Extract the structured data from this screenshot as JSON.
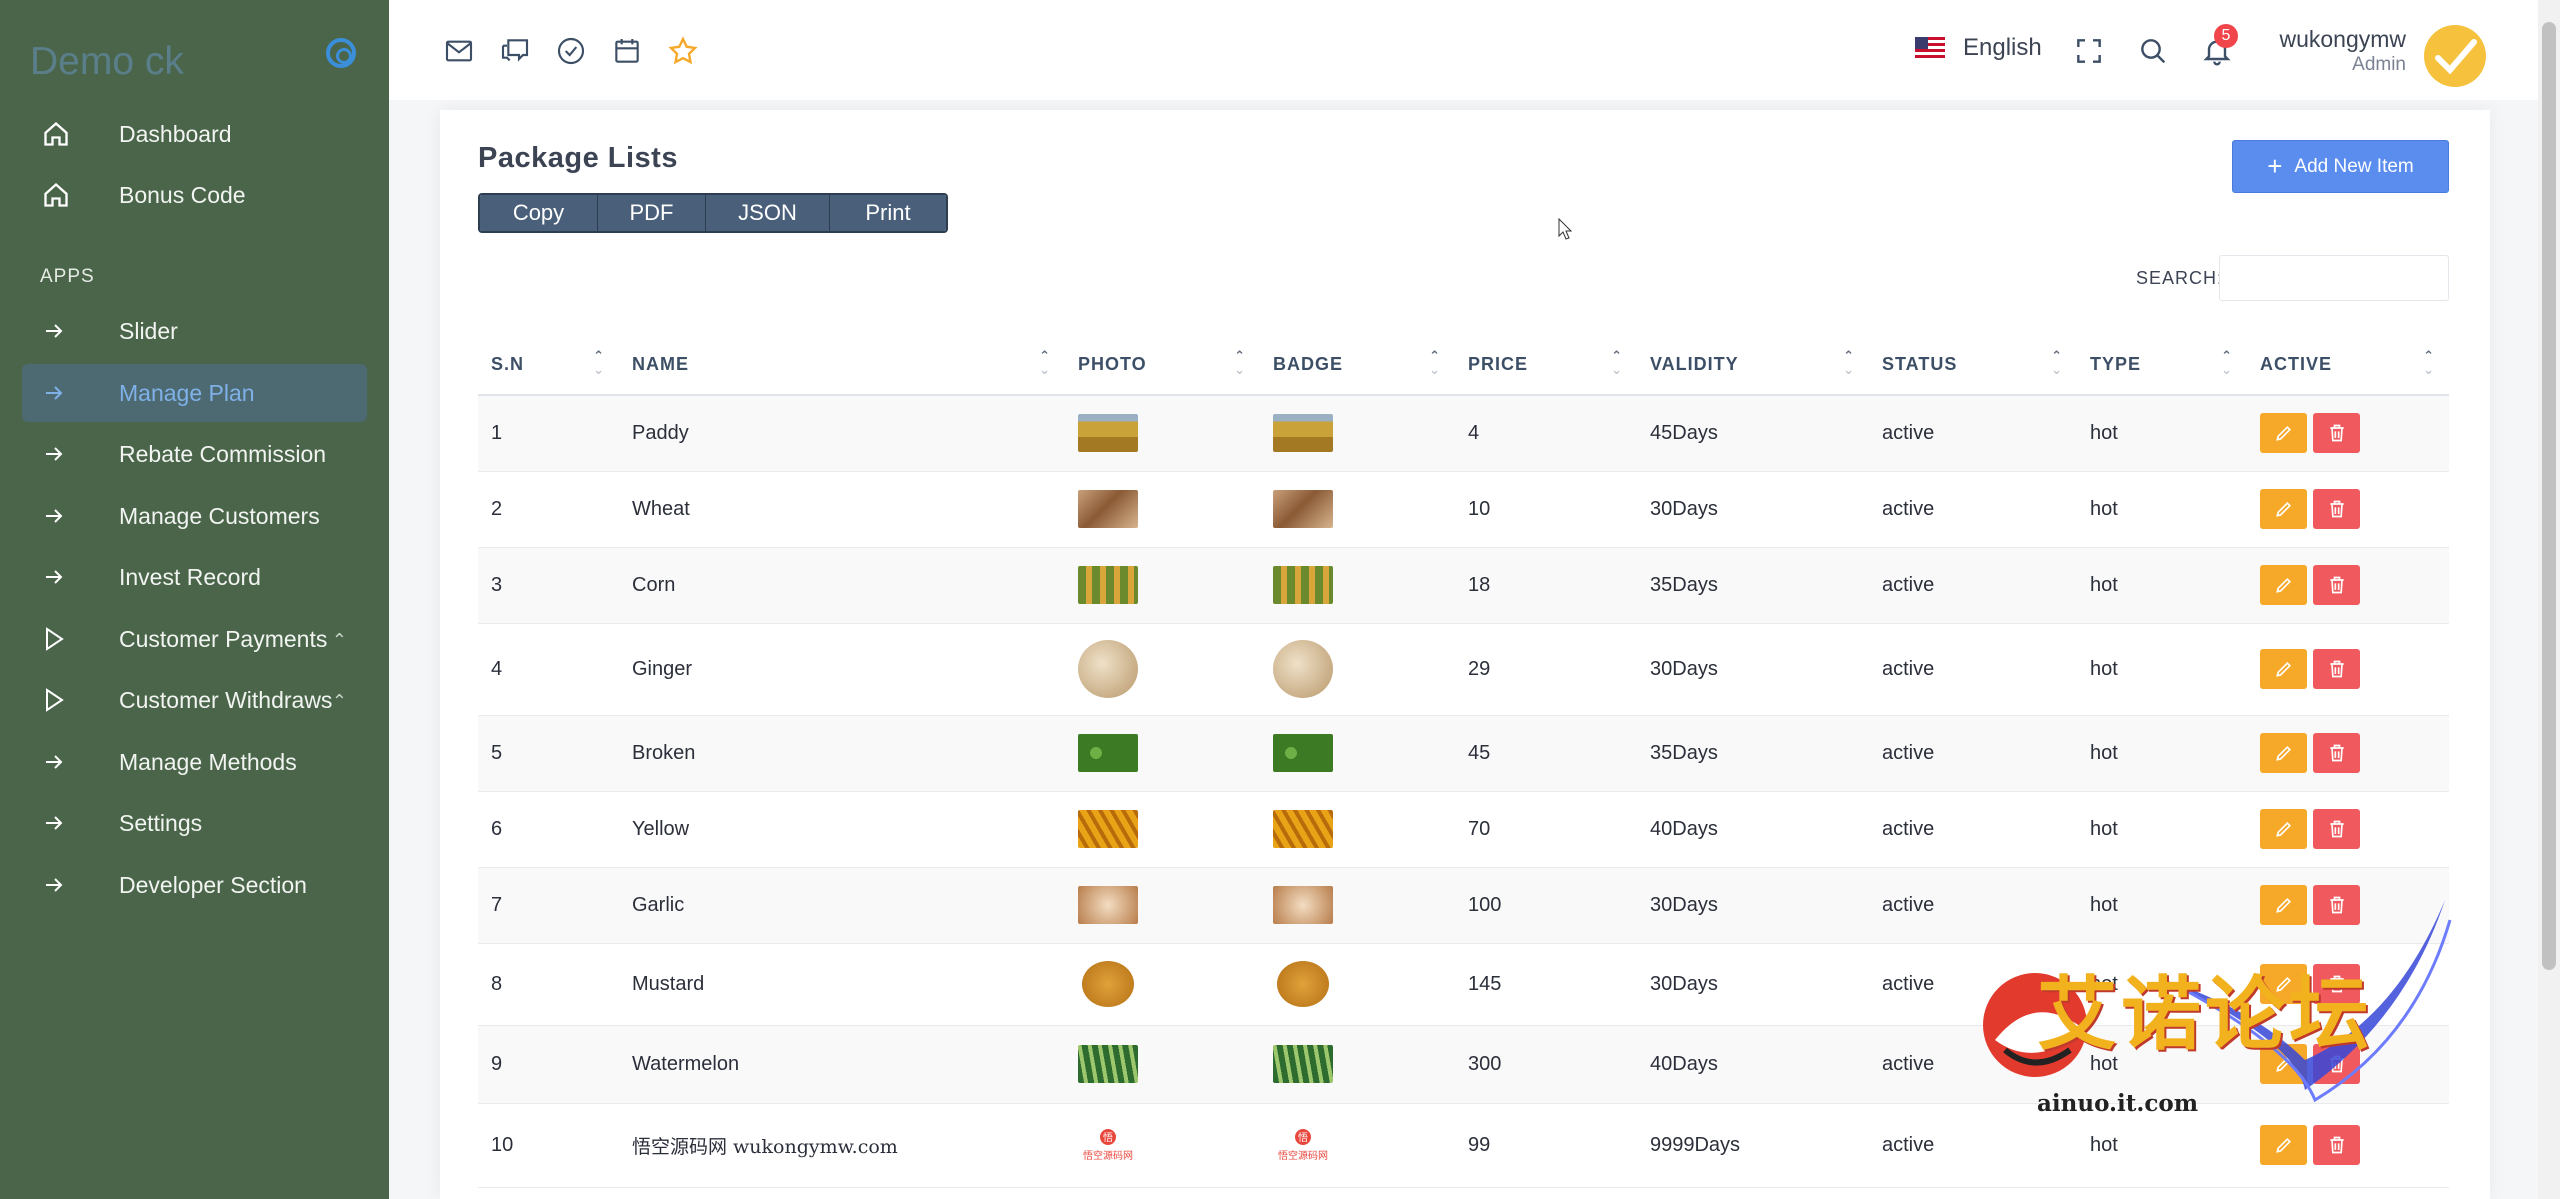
{
  "sidebar": {
    "brand": "Demo ck",
    "section_apps": "APPS",
    "items": [
      {
        "label": "Dashboard",
        "icon": "home-icon"
      },
      {
        "label": "Bonus Code",
        "icon": "home-icon"
      },
      {
        "label": "Slider",
        "icon": "arrow-right-icon"
      },
      {
        "label": "Manage Plan",
        "icon": "arrow-right-icon",
        "active": true
      },
      {
        "label": "Rebate Commission",
        "icon": "arrow-right-icon"
      },
      {
        "label": "Manage Customers",
        "icon": "arrow-right-icon"
      },
      {
        "label": "Invest Record",
        "icon": "arrow-right-icon"
      },
      {
        "label": "Customer Payments",
        "icon": "play-icon",
        "expandable": true
      },
      {
        "label": "Customer Withdraws",
        "icon": "play-icon",
        "expandable": true
      },
      {
        "label": "Manage Methods",
        "icon": "arrow-right-icon"
      },
      {
        "label": "Settings",
        "icon": "arrow-right-icon"
      },
      {
        "label": "Developer Section",
        "icon": "arrow-right-icon"
      }
    ]
  },
  "topbar": {
    "icons": [
      "mail-icon",
      "chat-icon",
      "check-circle-icon",
      "calendar-icon",
      "star-icon"
    ],
    "language": "English",
    "notifications_count": "5",
    "user_name": "wukongymw",
    "user_role": "Admin"
  },
  "main": {
    "title": "Package Lists",
    "export_buttons": [
      "Copy",
      "PDF",
      "JSON",
      "Print"
    ],
    "add_button": "Add New Item",
    "search_label": "SEARCH:",
    "search_value": "",
    "columns": [
      "S.N",
      "NAME",
      "PHOTO",
      "BADGE",
      "PRICE",
      "VALIDITY",
      "STATUS",
      "TYPE",
      "ACTIVE"
    ],
    "rows": [
      {
        "sn": "1",
        "name": "Paddy",
        "price": "4",
        "validity": "45Days",
        "status": "active",
        "type": "hot"
      },
      {
        "sn": "2",
        "name": "Wheat",
        "price": "10",
        "validity": "30Days",
        "status": "active",
        "type": "hot"
      },
      {
        "sn": "3",
        "name": "Corn",
        "price": "18",
        "validity": "35Days",
        "status": "active",
        "type": "hot"
      },
      {
        "sn": "4",
        "name": "Ginger",
        "price": "29",
        "validity": "30Days",
        "status": "active",
        "type": "hot"
      },
      {
        "sn": "5",
        "name": "Broken",
        "price": "45",
        "validity": "35Days",
        "status": "active",
        "type": "hot"
      },
      {
        "sn": "6",
        "name": "Yellow",
        "price": "70",
        "validity": "40Days",
        "status": "active",
        "type": "hot"
      },
      {
        "sn": "7",
        "name": "Garlic",
        "price": "100",
        "validity": "30Days",
        "status": "active",
        "type": "hot"
      },
      {
        "sn": "8",
        "name": "Mustard",
        "price": "145",
        "validity": "30Days",
        "status": "active",
        "type": "hot"
      },
      {
        "sn": "9",
        "name": "Watermelon",
        "price": "300",
        "validity": "40Days",
        "status": "active",
        "type": "hot"
      },
      {
        "sn": "10",
        "name": "悟空源码网 wukongymw.com",
        "price": "99",
        "validity": "9999Days",
        "status": "active",
        "type": "hot"
      }
    ]
  },
  "watermark": {
    "text": "艾诺论坛",
    "url": "ainuo.it.com"
  },
  "colors": {
    "sidebar_bg": "#4a654a",
    "active_item_bg": "#4d6a72",
    "primary": "#5b8def",
    "edit": "#f6a829",
    "delete": "#f05a5e"
  }
}
